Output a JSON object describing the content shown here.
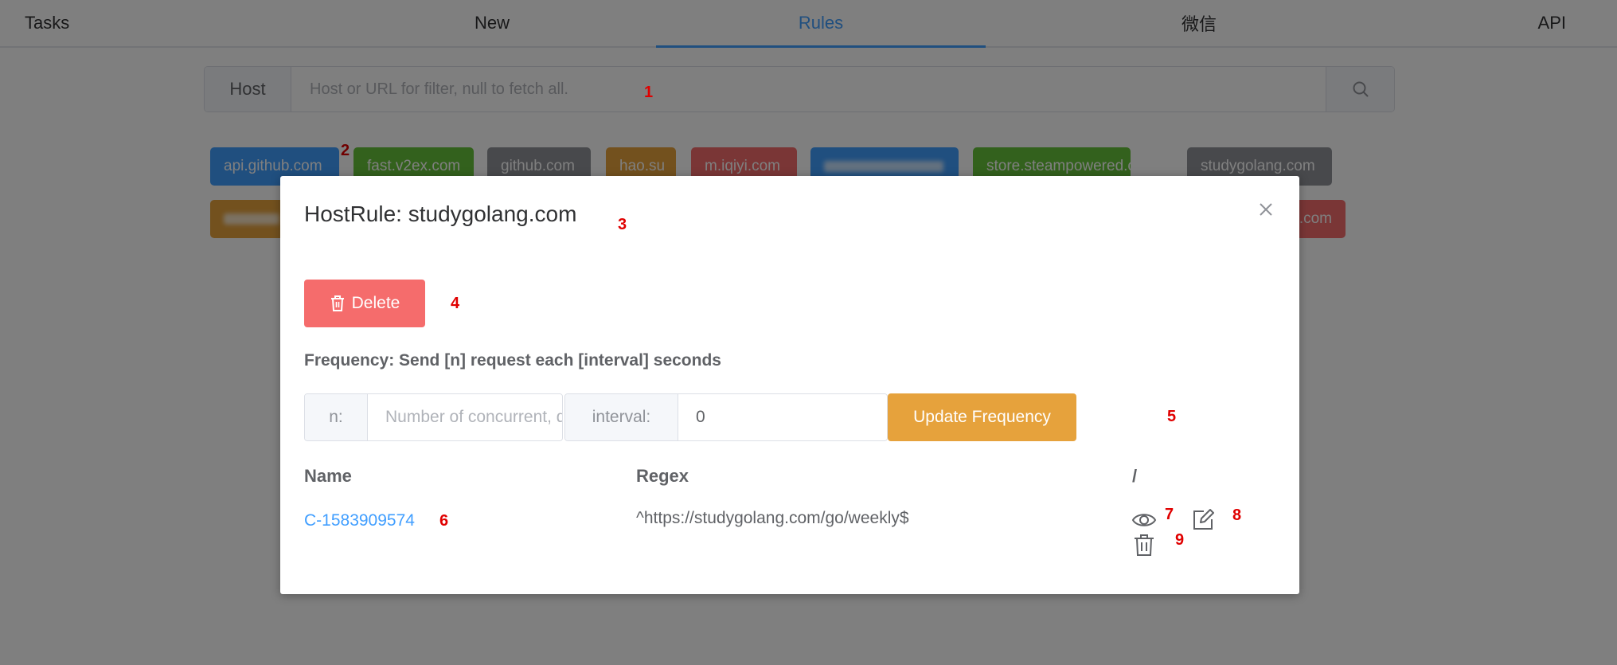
{
  "nav": {
    "tasks": "Tasks",
    "new": "New",
    "rules": "Rules",
    "wechat": "微信",
    "api": "API"
  },
  "search": {
    "prefix": "Host",
    "placeholder": "Host or URL for filter, null to fetch all."
  },
  "host_tags": [
    {
      "label": "api.github.com",
      "color": "#409eff"
    },
    {
      "label": "fast.v2ex.com",
      "color": "#67c23a"
    },
    {
      "label": "github.com",
      "color": "#909399"
    },
    {
      "label": "hao.su",
      "color": "#e6a23c"
    },
    {
      "label": "m.iqiyi.com",
      "color": "#f56c6c"
    },
    {
      "label": "",
      "color": "#409eff"
    },
    {
      "label": "store.steampowered.com",
      "color": "#67c23a"
    },
    {
      "label": "studygolang.com",
      "color": "#909399"
    },
    {
      "label": "",
      "color": "#e6a23c"
    },
    {
      "label": ".com",
      "color": "#f56c6c"
    }
  ],
  "modal": {
    "title": "HostRule: studygolang.com",
    "delete_label": "Delete",
    "frequency_label": "Frequency: Send [n] request each [interval] seconds",
    "n_label": "n:",
    "n_placeholder": "Number of concurrent, defa",
    "n_value": "",
    "interval_label": "interval:",
    "interval_value": "0",
    "update_label": "Update Frequency",
    "table": {
      "headers": [
        "Name",
        "Regex",
        "/"
      ],
      "rows": [
        {
          "name": "C-1583909574",
          "regex": "^https://studygolang.com/go/weekly$"
        }
      ]
    }
  },
  "annotations": [
    "1",
    "2",
    "3",
    "4",
    "5",
    "6",
    "7",
    "8",
    "9"
  ],
  "colors": {
    "primary": "#409eff",
    "success": "#67c23a",
    "info": "#909399",
    "warning": "#e6a23c",
    "danger": "#f56c6c"
  },
  "icons": [
    "search-icon",
    "close-icon",
    "trash-icon",
    "eye-icon",
    "edit-icon"
  ]
}
